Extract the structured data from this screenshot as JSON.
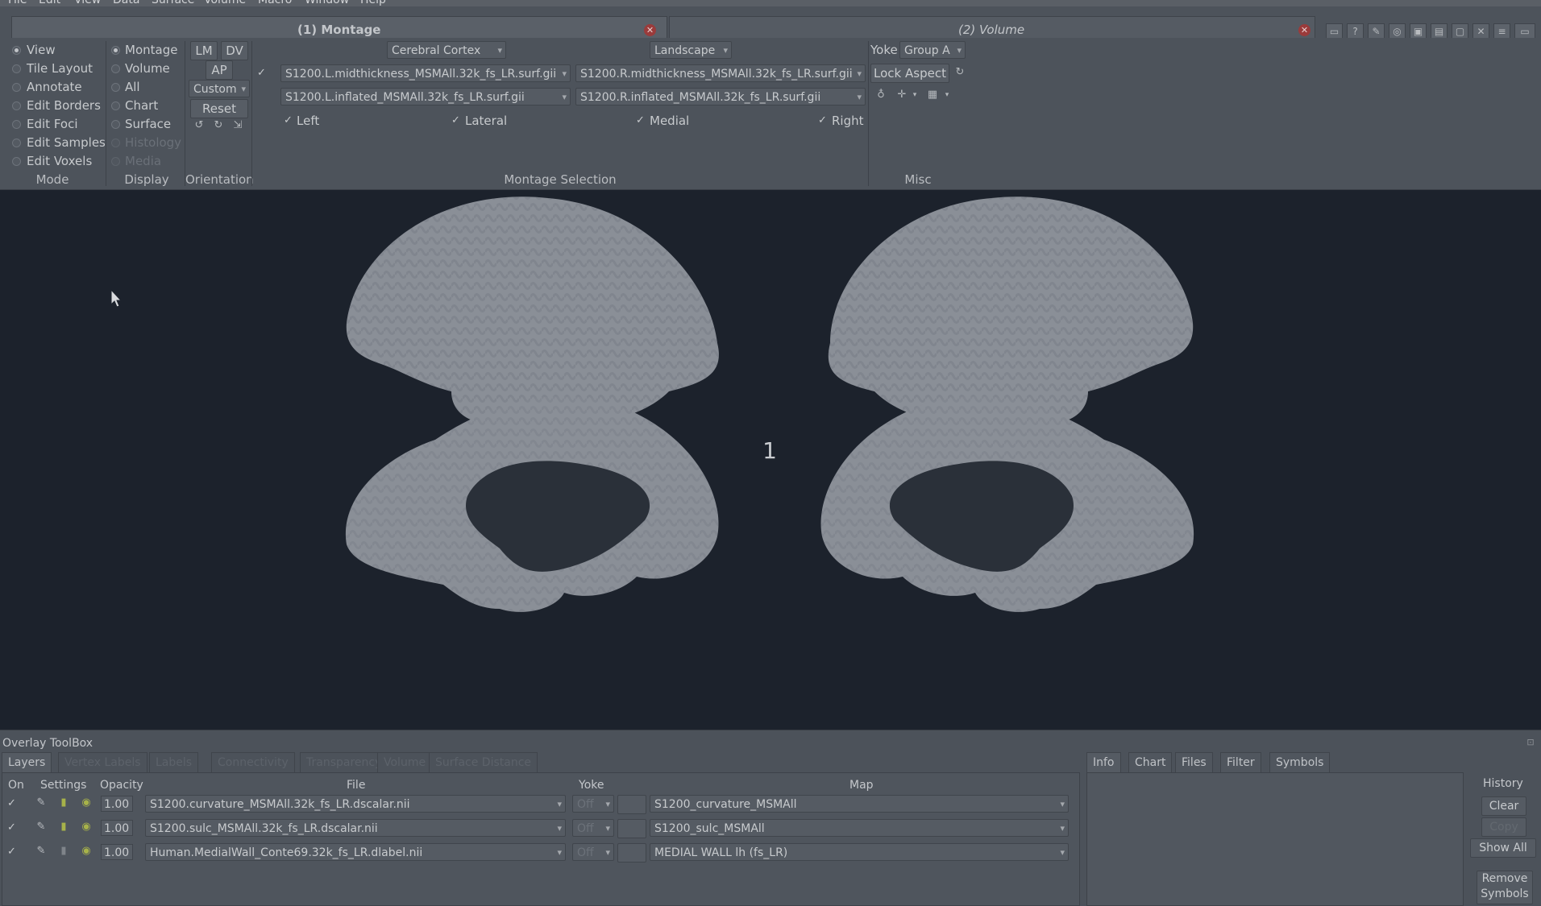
{
  "menubar": [
    "File",
    "Edit",
    "View",
    "Data",
    "Surface",
    "Volume",
    "Macro",
    "Window",
    "Help"
  ],
  "tabs": [
    {
      "label": "(1) Montage"
    },
    {
      "label": "(2) Volume"
    }
  ],
  "mode": {
    "group_label": "Mode",
    "items": [
      "View",
      "Tile Layout",
      "Annotate",
      "Edit Borders",
      "Edit Foci",
      "Edit Samples",
      "Edit Voxels"
    ],
    "selected": "View"
  },
  "display": {
    "group_label": "Display",
    "items": [
      "Montage",
      "Volume",
      "All",
      "Chart",
      "Surface",
      "Histology",
      "Media"
    ],
    "selected": "Montage"
  },
  "orientation": {
    "group_label": "Orientation",
    "buttons": [
      "LM",
      "DV",
      "AP"
    ],
    "custom": "Custom",
    "reset": "Reset"
  },
  "montage": {
    "group_label": "Montage Selection",
    "structure": "Cerebral Cortex",
    "layout": "Landscape",
    "left_surface_1": "S1200.L.midthickness_MSMAll.32k_fs_LR.surf.gii",
    "right_surface_1": "S1200.R.midthickness_MSMAll.32k_fs_LR.surf.gii",
    "left_surface_2": "S1200.L.inflated_MSMAll.32k_fs_LR.surf.gii",
    "right_surface_2": "S1200.R.inflated_MSMAll.32k_fs_LR.surf.gii",
    "checks": [
      "Left",
      "Lateral",
      "Medial",
      "Right"
    ],
    "check_mark": "✓"
  },
  "misc": {
    "group_label": "Misc",
    "yoke_label": "Yoke",
    "yoke_group": "Group A",
    "lock_aspect": "Lock Aspect"
  },
  "viewport": {
    "tile_number": "1"
  },
  "toolbox": {
    "title": "Overlay ToolBox",
    "tabs": [
      "Layers",
      "Vertex Labels",
      "Labels",
      "Connectivity",
      "Transparency",
      "Volume",
      "Surface Distance"
    ],
    "columns": {
      "on": "On",
      "settings": "Settings",
      "opacity": "Opacity",
      "file": "File",
      "yoke": "Yoke",
      "map": "Map"
    },
    "rows": [
      {
        "on": "✓",
        "opacity": "1.00",
        "file": "S1200.curvature_MSMAll.32k_fs_LR.dscalar.nii",
        "yoke": "Off",
        "map": "S1200_curvature_MSMAll"
      },
      {
        "on": "✓",
        "opacity": "1.00",
        "file": "S1200.sulc_MSMAll.32k_fs_LR.dscalar.nii",
        "yoke": "Off",
        "map": "S1200_sulc_MSMAll"
      },
      {
        "on": "✓",
        "opacity": "1.00",
        "file": "Human.MedialWall_Conte69.32k_fs_LR.dlabel.nii",
        "yoke": "Off",
        "map": "MEDIAL WALL lh (fs_LR)"
      }
    ]
  },
  "info_panel": {
    "tabs": [
      "Info",
      "Chart",
      "Files",
      "Filter",
      "Symbols"
    ],
    "history": "History",
    "clear": "Clear",
    "copy": "Copy",
    "show_all": "Show All",
    "remove_symbols": "Remove Symbols"
  }
}
